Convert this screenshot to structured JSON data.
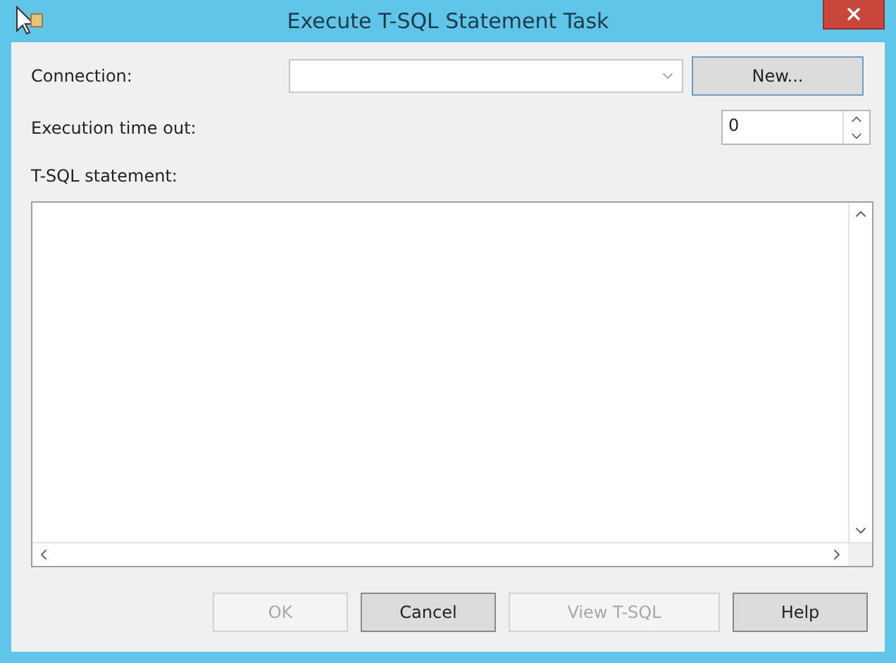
{
  "window": {
    "title": "Execute T-SQL Statement Task"
  },
  "connection": {
    "label": "Connection:",
    "button": "New..."
  },
  "timeout": {
    "label": "Execution time out:",
    "value": "0"
  },
  "statement": {
    "label": "T-SQL statement:"
  },
  "buttons": [
    {
      "label": "OK",
      "disabled": true
    },
    {
      "label": "Cancel",
      "disabled": false
    },
    {
      "label": "View T-SQL",
      "disabled": true
    },
    {
      "label": "Help",
      "disabled": false
    }
  ]
}
